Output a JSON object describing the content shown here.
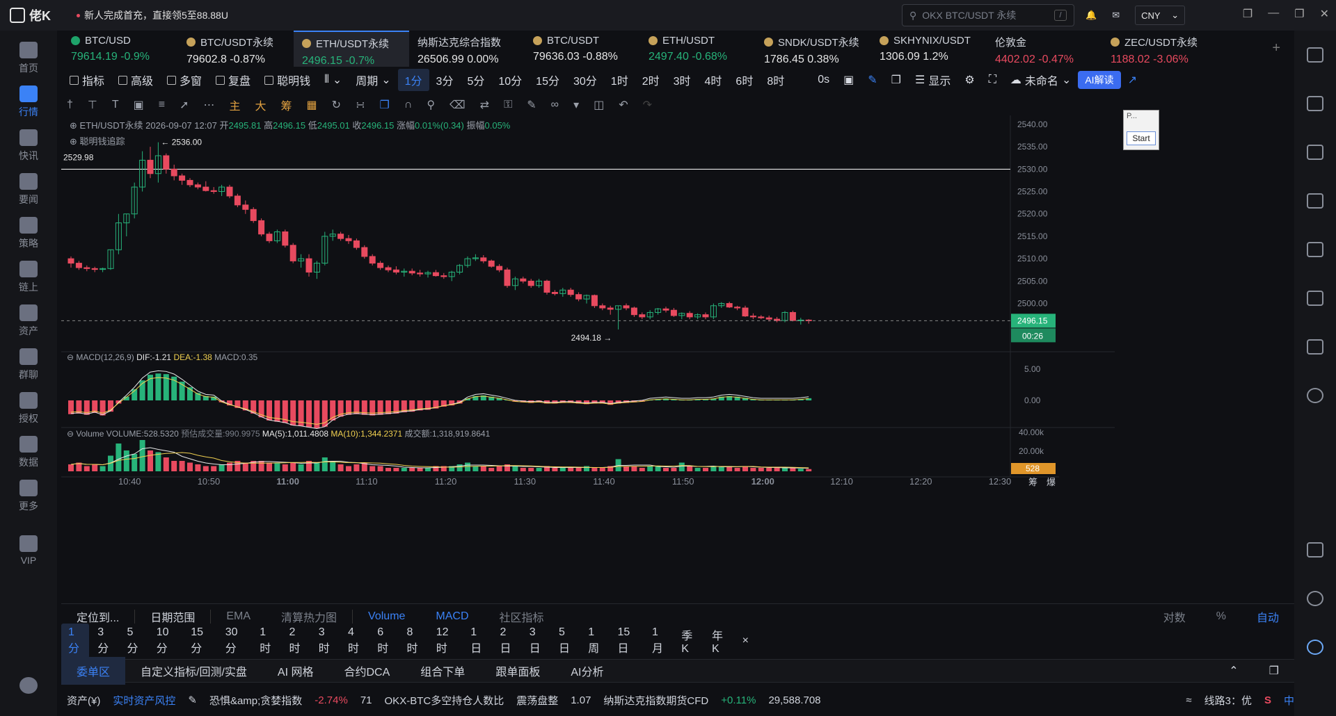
{
  "titlebar": {
    "app_name": "佬K",
    "promo": "新人完成首充，直接领5至88.88U",
    "search_placeholder": "OKX BTC/USDT 永续",
    "search_shortcut": "/",
    "currency": "CNY"
  },
  "sidebar": [
    {
      "label": "首页",
      "icon": "home-icon"
    },
    {
      "label": "行情",
      "icon": "market-icon",
      "active": true
    },
    {
      "label": "快讯",
      "icon": "flash-news-icon"
    },
    {
      "label": "要闻",
      "icon": "news-icon"
    },
    {
      "label": "策略",
      "icon": "strategy-icon"
    },
    {
      "label": "链上",
      "icon": "onchain-icon"
    },
    {
      "label": "资产",
      "icon": "assets-icon"
    },
    {
      "label": "群聊",
      "icon": "chat-icon"
    },
    {
      "label": "授权",
      "icon": "auth-icon"
    },
    {
      "label": "数据",
      "icon": "data-icon"
    },
    {
      "label": "更多",
      "icon": "more-icon"
    },
    {
      "label": "VIP",
      "icon": "vip-icon"
    }
  ],
  "tickers": [
    {
      "name": "BTC/USD",
      "price": "79614.19",
      "change": "-0.9%",
      "dir": "up",
      "coin": "g"
    },
    {
      "name": "BTC/USDT永续",
      "price": "79602.8",
      "change": "-0.87%",
      "dir": "flat"
    },
    {
      "name": "ETH/USDT永续",
      "price": "2496.15",
      "change": "-0.7%",
      "dir": "up",
      "active": true
    },
    {
      "name": "纳斯达克综合指数",
      "price": "26506.99",
      "change": "0.00%",
      "dir": "flat",
      "nocoin": true
    },
    {
      "name": "BTC/USDT",
      "price": "79636.03",
      "change": "-0.88%",
      "dir": "flat"
    },
    {
      "name": "ETH/USDT",
      "price": "2497.40",
      "change": "-0.68%",
      "dir": "up"
    },
    {
      "name": "SNDK/USDT永续",
      "price": "1786.45",
      "change": "0.38%",
      "dir": "flat"
    },
    {
      "name": "SKHYNIX/USDT",
      "price": "1306.09",
      "change": "1.2%",
      "dir": "flat"
    },
    {
      "name": "伦敦金",
      "price": "4402.02",
      "change": "-0.47%",
      "dir": "dn",
      "nocoin": true
    },
    {
      "name": "ZEC/USDT永续",
      "price": "1188.02",
      "change": "-3.06%",
      "dir": "dn"
    }
  ],
  "toolbar1": {
    "left": [
      "指标",
      "高级",
      "多窗",
      "复盘",
      "聪明钱"
    ],
    "cycle_label": "周期",
    "periods": [
      "1分",
      "3分",
      "5分",
      "10分",
      "15分",
      "30分",
      "1时",
      "2时",
      "3时",
      "4时",
      "6时",
      "8时"
    ],
    "selected_period": "1分",
    "seconds": "0s",
    "display_label": "显示",
    "unnamed_label": "未命名",
    "ai_button": "AI解读"
  },
  "toolbar2": [
    "主",
    "大",
    "筹"
  ],
  "chart_info": {
    "symbol": "ETH/USDT永续",
    "datetime": "2026-09-07 12:07",
    "open_label": "开",
    "open": "2495.81",
    "high_label": "高",
    "high": "2496.15",
    "low_label": "低",
    "low": "2495.01",
    "close_label": "收",
    "close": "2496.15",
    "change_label": "涨幅",
    "change": "0.01%(0.34)",
    "amp_label": "振幅",
    "amp": "0.05%",
    "overlay": "聪明钱追踪"
  },
  "macd_info": {
    "label": "MACD(12,26,9)",
    "dif": "DIF:-1.21",
    "dea": "DEA:-1.38",
    "macd": "MACD:0.35"
  },
  "vol_info": {
    "label": "Volume",
    "volume": "VOLUME:528.5320",
    "est": "预估成交量:990.9975",
    "ma5": "MA(5):1,011.4808",
    "ma10": "MA(10):1,344.2371",
    "amount": "成交额:1,318,919.8641"
  },
  "popup": {
    "title": "P...",
    "button": "Start"
  },
  "chart_data": {
    "type": "candlestick",
    "price_axis": [
      "2540.00",
      "2535.00",
      "2530.00",
      "2525.00",
      "2520.00",
      "2515.00",
      "2510.00",
      "2505.00",
      "2500.00"
    ],
    "macd_axis": [
      "5.00",
      "0.00"
    ],
    "vol_axis": [
      "40.00k",
      "20.00k"
    ],
    "time_axis": [
      "10:40",
      "10:50",
      "11:00",
      "11:10",
      "11:20",
      "11:30",
      "11:40",
      "11:50",
      "12:00",
      "12:10",
      "12:20",
      "12:30"
    ],
    "ylim": [
      2490,
      2542
    ],
    "hline_label": "2529.98",
    "hline_value": 2529.98,
    "high_label": "2536.00",
    "low_label": "2494.18",
    "last_price": "2496.15",
    "countdown": "00:26",
    "vol_tag": "528",
    "right_labels": [
      "筹",
      "爆"
    ],
    "candles": [
      [
        2510,
        2510.5,
        2508,
        2509
      ],
      [
        2509,
        2509.5,
        2507.5,
        2508
      ],
      [
        2508,
        2508.5,
        2507.2,
        2507.8
      ],
      [
        2507.8,
        2508.2,
        2507,
        2507.6
      ],
      [
        2507.6,
        2508,
        2507,
        2507.8
      ],
      [
        2507.8,
        2512,
        2507.5,
        2512
      ],
      [
        2512,
        2520,
        2511,
        2518
      ],
      [
        2518,
        2520,
        2515,
        2520
      ],
      [
        2520,
        2527,
        2519,
        2526
      ],
      [
        2526,
        2534,
        2525,
        2532
      ],
      [
        2532,
        2535,
        2528,
        2529
      ],
      [
        2529,
        2536,
        2527,
        2533
      ],
      [
        2533,
        2533.5,
        2529,
        2530
      ],
      [
        2530,
        2531,
        2527.5,
        2528.5
      ],
      [
        2528.5,
        2529,
        2526.5,
        2527.5
      ],
      [
        2527.5,
        2528,
        2526,
        2526.5
      ],
      [
        2526.5,
        2527,
        2525.5,
        2526
      ],
      [
        2526,
        2527.3,
        2525,
        2525.2
      ],
      [
        2525.2,
        2526,
        2524.5,
        2525
      ],
      [
        2525,
        2526.5,
        2524,
        2526
      ],
      [
        2526,
        2526.5,
        2523.5,
        2524
      ],
      [
        2524,
        2524.5,
        2521.5,
        2522
      ],
      [
        2522,
        2523,
        2520,
        2521
      ],
      [
        2521,
        2521.5,
        2518,
        2518.5
      ],
      [
        2518.5,
        2519,
        2515,
        2515.5
      ],
      [
        2515.5,
        2516,
        2513.5,
        2514
      ],
      [
        2514,
        2516.5,
        2513.5,
        2516
      ],
      [
        2516,
        2516.5,
        2512.5,
        2513
      ],
      [
        2513,
        2513.5,
        2509,
        2509.5
      ],
      [
        2509.5,
        2511,
        2508,
        2510
      ],
      [
        2510,
        2511,
        2506,
        2507
      ],
      [
        2507,
        2509.5,
        2505.5,
        2509
      ],
      [
        2509,
        2516,
        2508.5,
        2515
      ],
      [
        2515,
        2516.5,
        2514,
        2515.5
      ],
      [
        2515.5,
        2516,
        2514,
        2514.5
      ],
      [
        2514.5,
        2515.3,
        2513.3,
        2514
      ],
      [
        2514,
        2514.5,
        2512,
        2512.5
      ],
      [
        2512.5,
        2513,
        2510,
        2510.5
      ],
      [
        2510.5,
        2511,
        2508.5,
        2509
      ],
      [
        2509,
        2509.5,
        2507.5,
        2508
      ],
      [
        2508,
        2508.5,
        2507,
        2507.5
      ],
      [
        2507.5,
        2508.3,
        2506.5,
        2507
      ],
      [
        2507,
        2507.8,
        2506,
        2507.2
      ],
      [
        2507.2,
        2507.8,
        2506.3,
        2506.8
      ],
      [
        2506.8,
        2507.5,
        2506,
        2506.6
      ],
      [
        2506.6,
        2507.3,
        2505.8,
        2506.9
      ],
      [
        2506.9,
        2507.5,
        2506,
        2506.2
      ],
      [
        2506.2,
        2506.8,
        2505.5,
        2506
      ],
      [
        2506,
        2507.3,
        2505,
        2507
      ],
      [
        2507,
        2508.8,
        2506.5,
        2508.5
      ],
      [
        2508.5,
        2510.5,
        2508,
        2510
      ],
      [
        2510,
        2511,
        2509.5,
        2510.2
      ],
      [
        2510.2,
        2510.8,
        2509,
        2509.5
      ],
      [
        2509.5,
        2509.8,
        2508,
        2508.3
      ],
      [
        2508.3,
        2508.8,
        2507,
        2507.5
      ],
      [
        2507.5,
        2508,
        2503.5,
        2504
      ],
      [
        2504,
        2506,
        2503,
        2505.5
      ],
      [
        2505.5,
        2506,
        2504.5,
        2505
      ],
      [
        2505,
        2505.5,
        2503.5,
        2504
      ],
      [
        2504,
        2505.5,
        2503.5,
        2505
      ],
      [
        2505,
        2505.3,
        2502,
        2502.5
      ],
      [
        2502.5,
        2503,
        2501.8,
        2502.2
      ],
      [
        2502.2,
        2503.5,
        2501.5,
        2503
      ],
      [
        2503,
        2503.5,
        2501.5,
        2502
      ],
      [
        2502,
        2502.5,
        2500.5,
        2501
      ],
      [
        2501,
        2502,
        2500,
        2501.8
      ],
      [
        2501.8,
        2502,
        2499,
        2499.5
      ],
      [
        2499.5,
        2500,
        2498.5,
        2499
      ],
      [
        2499,
        2499.5,
        2497.5,
        2498.7
      ],
      [
        2498.7,
        2499.5,
        2494.2,
        2499.5
      ],
      [
        2499.5,
        2500,
        2498.5,
        2499
      ],
      [
        2499,
        2499.3,
        2497,
        2497.5
      ],
      [
        2497.5,
        2498,
        2496.5,
        2497
      ],
      [
        2497,
        2498.5,
        2496.5,
        2498
      ],
      [
        2498,
        2499,
        2497.5,
        2498.8
      ],
      [
        2498.8,
        2499.3,
        2498,
        2498.5
      ],
      [
        2498.5,
        2499,
        2497,
        2497.3
      ],
      [
        2497.3,
        2498,
        2496.5,
        2497.8
      ],
      [
        2497.8,
        2498.3,
        2496.5,
        2497
      ],
      [
        2497,
        2497.8,
        2496.5,
        2497.5
      ],
      [
        2497.5,
        2498,
        2496.5,
        2497
      ],
      [
        2497,
        2500,
        2496.5,
        2499.5
      ],
      [
        2499.5,
        2500.3,
        2499,
        2500
      ],
      [
        2500,
        2500.4,
        2499,
        2499.2
      ],
      [
        2499.2,
        2499.5,
        2498.5,
        2499
      ],
      [
        2499,
        2499.5,
        2497,
        2497.2
      ],
      [
        2497.2,
        2497.8,
        2496.5,
        2497
      ],
      [
        2497,
        2497.4,
        2496.5,
        2496.8
      ],
      [
        2496.8,
        2497.3,
        2496,
        2496.5
      ],
      [
        2496.5,
        2497,
        2495.8,
        2496.2
      ],
      [
        2496.2,
        2498.3,
        2495.8,
        2498
      ],
      [
        2498,
        2498.4,
        2496,
        2496.2
      ],
      [
        2496.2,
        2496.8,
        2495.3,
        2496.3
      ],
      [
        2496.3,
        2496.5,
        2495.5,
        2496.15
      ]
    ],
    "macd_hist": [
      -2.2,
      -2.1,
      -2.3,
      -2.0,
      -2.4,
      -1.8,
      -0.5,
      0.6,
      1.8,
      3.2,
      4.1,
      4.3,
      4.2,
      3.8,
      3.0,
      2.1,
      1.2,
      0.7,
      0.6,
      -0.3,
      -0.8,
      -1.2,
      -1.6,
      -2.1,
      -2.7,
      -3.2,
      -3.4,
      -3.6,
      -4.0,
      -4.1,
      -4.3,
      -4.5,
      -4.2,
      -3.2,
      -2.6,
      -2.3,
      -2.2,
      -2.3,
      -2.4,
      -2.3,
      -2.2,
      -2.1,
      -1.9,
      -1.8,
      -1.6,
      -1.5,
      -1.3,
      -1.0,
      -0.8,
      -0.5,
      0.3,
      0.7,
      0.8,
      0.6,
      0.4,
      0.1,
      -0.2,
      -0.3,
      -0.4,
      -0.3,
      -0.5,
      -0.5,
      -0.4,
      -0.4,
      -0.5,
      -0.6,
      -0.5,
      -0.5,
      -0.7,
      -0.5,
      -0.4,
      -0.3,
      -0.2,
      0.1,
      0.2,
      0.3,
      0.2,
      0.1,
      0.1,
      0.2,
      0.2,
      0.3,
      0.6,
      0.7,
      0.6,
      0.4,
      0.2,
      0.1,
      0.1,
      0.1,
      0.1,
      0.1,
      0.2,
      0.35
    ],
    "volume": [
      4,
      5,
      3,
      4,
      3,
      9,
      16,
      12,
      10,
      18,
      12,
      11,
      8,
      6,
      6,
      5,
      4,
      3,
      3,
      4,
      5,
      6,
      5,
      6,
      6,
      5,
      5,
      4,
      5,
      4,
      6,
      5,
      8,
      6,
      4,
      3,
      4,
      5,
      3,
      3,
      2,
      2,
      2,
      2,
      2,
      2,
      3,
      3,
      3,
      4,
      5,
      3,
      3,
      2,
      3,
      4,
      3,
      2,
      2,
      2,
      3,
      2,
      2,
      2,
      2,
      3,
      2,
      2,
      3,
      7,
      3,
      3,
      2,
      3,
      3,
      2,
      2,
      5,
      3,
      2,
      2,
      3,
      3,
      3,
      2,
      3,
      2,
      2,
      2,
      2,
      2,
      2,
      1.5,
      1.3
    ]
  },
  "timeframe_bar": {
    "locate": "定位到...",
    "date_range": "日期范围",
    "items": [
      "EMA",
      "清算热力图",
      "Volume",
      "MACD",
      "社区指标"
    ],
    "right": [
      "对数",
      "%",
      "自动"
    ]
  },
  "ranges": [
    "1分",
    "3分",
    "5分",
    "10分",
    "15分",
    "30分",
    "1时",
    "2时",
    "3时",
    "4时",
    "6时",
    "8时",
    "12时",
    "1日",
    "2日",
    "3日",
    "5日",
    "1周",
    "15日",
    "1月",
    "季K",
    "年K",
    "×"
  ],
  "bottom_tabs": [
    "委单区",
    "自定义指标/回测/实盘",
    "AI 网格",
    "合约DCA",
    "组合下单",
    "跟单面板",
    "AI分析"
  ],
  "statusbar": {
    "assets": "资产(¥)",
    "risk": "实时资产风控",
    "fear_label": "恐惧&amp;贪婪指数",
    "fear_change": "-2.74%",
    "fear_value": "71",
    "okx_label": "OKX-BTC多空持仓人数比",
    "okx_state": "震荡盘整",
    "okx_value": "1.07",
    "nasdaq_label": "纳斯达克指数期货CFD",
    "nasdaq_change": "+0.11%",
    "nasdaq_value": "29,588.708",
    "line": "线路3：优",
    "ime": "中"
  },
  "colors": {
    "up": "#27b37a",
    "down": "#e84a5f",
    "accent": "#3b82f6",
    "bg": "#0f1014"
  }
}
